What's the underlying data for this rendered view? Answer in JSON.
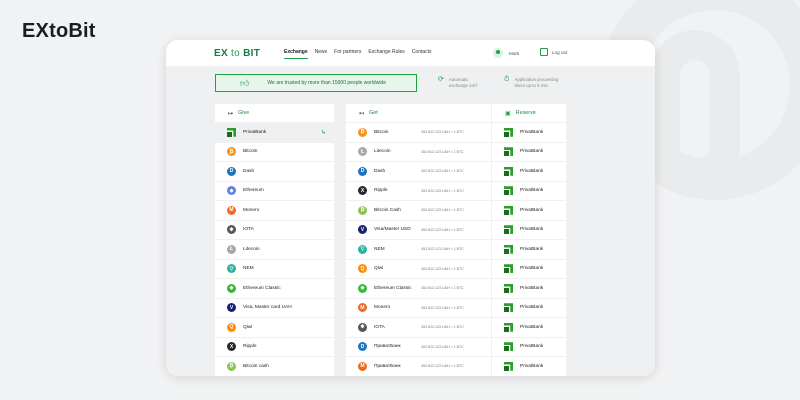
{
  "brand": "EXtoBit",
  "app": {
    "logo_part1": "EX",
    "logo_part2": "to",
    "logo_part3": "BIT",
    "nav": [
      "Exchange",
      "News",
      "For partners",
      "Exchange Rules",
      "Contacts"
    ],
    "active_nav": "Exchange",
    "user": "Mark",
    "logout": "Log out"
  },
  "banner": {
    "trust": "We are trusted by more than 15000 people worldwide",
    "feature1": [
      "Automatic",
      "exchange 24/7"
    ],
    "feature2": [
      "Application processing",
      "times up to 5 min"
    ]
  },
  "give": {
    "title": "Give",
    "items": [
      {
        "name": "PrivatBank",
        "icon": "privatbank-icon",
        "selected": true
      },
      {
        "name": "Bitcoin",
        "icon": "bitcoin-icon",
        "color": "#f7931a",
        "glyph": "₿"
      },
      {
        "name": "Dash",
        "icon": "dash-icon",
        "color": "#1c75bc",
        "glyph": "D"
      },
      {
        "name": "Ethereum",
        "icon": "ethereum-icon",
        "color": "#627eea",
        "glyph": "◆"
      },
      {
        "name": "Monero",
        "icon": "monero-icon",
        "color": "#f26822",
        "glyph": "M"
      },
      {
        "name": "IOTA",
        "icon": "iota-icon",
        "color": "#555555",
        "glyph": "✱"
      },
      {
        "name": "Litecoin",
        "icon": "litecoin-icon",
        "color": "#a6a9aa",
        "glyph": "Ł"
      },
      {
        "name": "NEM",
        "icon": "nem-icon",
        "color": "#2bb3a0",
        "glyph": "▽"
      },
      {
        "name": "Ethereum Classic",
        "icon": "ethereum-classic-icon",
        "color": "#3ab83a",
        "glyph": "◆"
      },
      {
        "name": "Visa, Master card UAH",
        "icon": "visa-mastercard-icon",
        "color": "#1a1f71",
        "glyph": "V"
      },
      {
        "name": "Qiwi",
        "icon": "qiwi-icon",
        "color": "#ff8c00",
        "glyph": "Q"
      },
      {
        "name": "Ripple",
        "icon": "ripple-icon",
        "color": "#23292f",
        "glyph": "X"
      },
      {
        "name": "Bitcoin cash",
        "icon": "bitcoin-cash-icon",
        "color": "#8dc351",
        "glyph": "₿"
      }
    ]
  },
  "get": {
    "title": "Get",
    "items": [
      {
        "name": "Bitcoin",
        "icon": "bitcoin-icon",
        "color": "#f7931a",
        "glyph": "₿",
        "rate": "453 812.123 UAH = 1 BTC"
      },
      {
        "name": "Litecoin",
        "icon": "litecoin-icon",
        "color": "#a6a9aa",
        "glyph": "Ł",
        "rate": "453 812.123 UAH = 1 BTC"
      },
      {
        "name": "Dash",
        "icon": "dash-icon",
        "color": "#1c75bc",
        "glyph": "D",
        "rate": "453 812.123 UAH = 1 BTC"
      },
      {
        "name": "Ripple",
        "icon": "ripple-icon",
        "color": "#23292f",
        "glyph": "X",
        "rate": "453 812.123 UAH = 1 BTC"
      },
      {
        "name": "Bitcoin Cash",
        "icon": "bitcoin-cash-icon",
        "color": "#8dc351",
        "glyph": "₿",
        "rate": "453 812.123 UAH = 1 BTC"
      },
      {
        "name": "Visa/Master USD",
        "icon": "visa-mastercard-icon",
        "color": "#1a1f71",
        "glyph": "V",
        "rate": "453 812.123 UAH = 1 BTC"
      },
      {
        "name": "NEM",
        "icon": "nem-icon",
        "color": "#2bb3a0",
        "glyph": "▽",
        "rate": "453 812.123 UAH = 1 BTC"
      },
      {
        "name": "Qiwi",
        "icon": "qiwi-icon",
        "color": "#ff8c00",
        "glyph": "Q",
        "rate": "453 812.123 UAH = 1 BTC"
      },
      {
        "name": "Ethereum Classic",
        "icon": "ethereum-classic-icon",
        "color": "#3ab83a",
        "glyph": "◆",
        "rate": "453 812.123 UAH = 1 BTC"
      },
      {
        "name": "Monero",
        "icon": "monero-icon",
        "color": "#f26822",
        "glyph": "M",
        "rate": "453 812.123 UAH = 1 BTC"
      },
      {
        "name": "IOTA",
        "icon": "iota-icon",
        "color": "#555555",
        "glyph": "✱",
        "rate": "453 812.123 UAH = 1 BTC"
      },
      {
        "name": "ПриватБанк",
        "icon": "dash-icon",
        "color": "#1c75bc",
        "glyph": "D",
        "rate": "453 812.123 UAH = 1 BTC"
      },
      {
        "name": "ПриватБанк",
        "icon": "monero-icon",
        "color": "#f26822",
        "glyph": "M",
        "rate": "453 812.123 UAH = 1 BTC"
      }
    ]
  },
  "reserve": {
    "title": "Reserve",
    "items": [
      "PrivatBank",
      "PrivatBank",
      "PrivatBank",
      "PrivatBank",
      "PrivatBank",
      "PrivatBank",
      "PrivatBank",
      "PrivatBank",
      "PrivatBank",
      "PrivatBank",
      "PrivatBank",
      "PrivatBank",
      "PrivatBank"
    ]
  },
  "colors": {
    "accent": "#22a046",
    "privatbank": "#2a9e2a"
  }
}
